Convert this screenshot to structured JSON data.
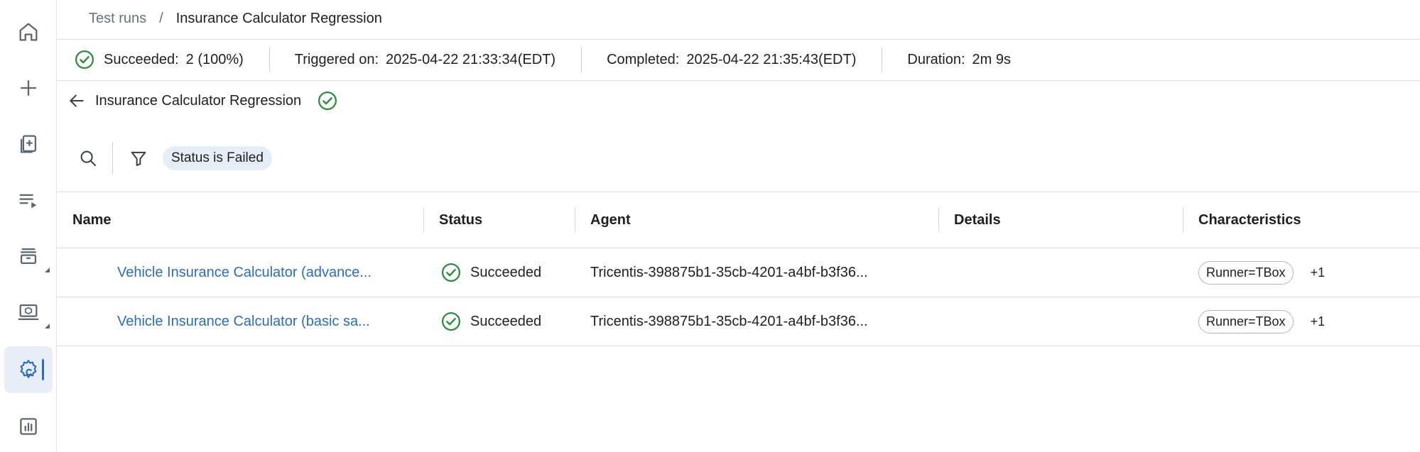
{
  "colors": {
    "accent": "#2a6ebb",
    "success": "#2e8b3e",
    "chip_bg": "#e7edf6"
  },
  "sidebar": {
    "items": [
      {
        "name": "home",
        "icon": "home-icon"
      },
      {
        "name": "create",
        "icon": "plus-icon"
      },
      {
        "name": "test-cases",
        "icon": "clipboard-add-icon"
      },
      {
        "name": "playlists",
        "icon": "playlist-icon"
      },
      {
        "name": "archive",
        "icon": "archive-icon"
      },
      {
        "name": "agents",
        "icon": "monitor-cube-icon"
      },
      {
        "name": "settings",
        "icon": "gear-icon",
        "active": true
      },
      {
        "name": "reports",
        "icon": "bar-chart-icon"
      }
    ]
  },
  "breadcrumb": {
    "parent": "Test runs",
    "separator": "/",
    "current": "Insurance Calculator Regression"
  },
  "summary": {
    "succeeded_label": "Succeeded:",
    "succeeded_value": "2 (100%)",
    "triggered_label": "Triggered on:",
    "triggered_value": "2025-04-22 21:33:34(EDT)",
    "completed_label": "Completed:",
    "completed_value": "2025-04-22 21:35:43(EDT)",
    "duration_label": "Duration:",
    "duration_value": "2m 9s"
  },
  "title": "Insurance Calculator Regression",
  "filter": {
    "chip": "Status is Failed"
  },
  "table": {
    "columns": [
      "Name",
      "Status",
      "Agent",
      "Details",
      "Characteristics"
    ],
    "rows": [
      {
        "name": "Vehicle Insurance Calculator (advance...",
        "status": "Succeeded",
        "agent": "Tricentis-398875b1-35cb-4201-a4bf-b3f36...",
        "details": "",
        "tag": "Runner=TBox",
        "more": "+1"
      },
      {
        "name": "Vehicle Insurance Calculator (basic sa...",
        "status": "Succeeded",
        "agent": "Tricentis-398875b1-35cb-4201-a4bf-b3f36...",
        "details": "",
        "tag": "Runner=TBox",
        "more": "+1"
      }
    ]
  }
}
